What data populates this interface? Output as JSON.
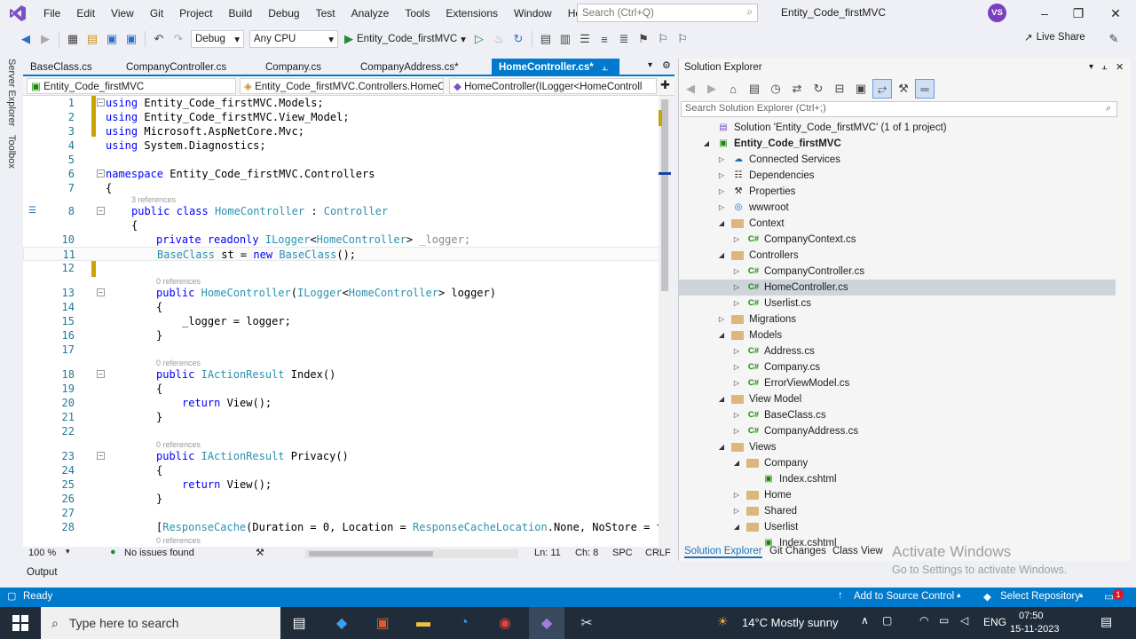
{
  "menubar": {
    "items": [
      "File",
      "Edit",
      "View",
      "Git",
      "Project",
      "Build",
      "Debug",
      "Test",
      "Analyze",
      "Tools",
      "Extensions",
      "Window",
      "Help"
    ],
    "search_placeholder": "Search (Ctrl+Q)",
    "solution_name": "Entity_Code_firstMVC",
    "avatar_initials": "VS"
  },
  "toolbar": {
    "config": "Debug",
    "platform": "Any CPU",
    "run_target": "Entity_Code_firstMVC",
    "live_share": "Live Share"
  },
  "left_rail": {
    "server_explorer": "Server Explorer",
    "toolbox": "Toolbox"
  },
  "tabs": [
    {
      "label": "BaseClass.cs"
    },
    {
      "label": "CompanyController.cs"
    },
    {
      "label": "Company.cs"
    },
    {
      "label": "CompanyAddress.cs*"
    },
    {
      "label": "HomeController.cs*"
    }
  ],
  "nav": {
    "project": "Entity_Code_firstMVC",
    "type": "Entity_Code_firstMVC.Controllers.HomeC",
    "member": "HomeController(ILogger<HomeControll"
  },
  "code": {
    "l1": "1",
    "l2": "2",
    "l3": "3",
    "l4": "4",
    "l5": "5",
    "l6": "6",
    "l7": "7",
    "l8": "8",
    "l10": "10",
    "l11": "11",
    "l12": "12",
    "l13": "13",
    "l14": "14",
    "l15": "15",
    "l16": "16",
    "l17": "17",
    "l18": "18",
    "l19": "19",
    "l20": "20",
    "l21": "21",
    "l22": "22",
    "l23": "23",
    "l24": "24",
    "l25": "25",
    "l26": "26",
    "l27": "27",
    "l28": "28",
    "using1": "Entity_Code_firstMVC.Models;",
    "using2": "Entity_Code_firstMVC.View_Model;",
    "using3": "Microsoft.AspNetCore.Mvc;",
    "using4": "System.Diagnostics;",
    "kw_using": "using",
    "kw_namespace": "namespace",
    "namespace_name": " Entity_Code_firstMVC.Controllers",
    "brace_open": "{",
    "brace_close": "}",
    "refs3": "3 references",
    "refs0": "0 references",
    "kw_public": "public",
    "kw_class": "class",
    "class_name": "HomeController",
    "colon": " : ",
    "base_type": "Controller",
    "kw_private": "private",
    "kw_readonly": "readonly",
    "ilogger": "ILogger",
    "lt": "<",
    "gt": ">",
    "logger_field": " _logger;",
    "baseclass": "BaseClass",
    "st_assign": " st = ",
    "kw_new": "new",
    "baseclass_ctor": "BaseClass",
    "ctor_end": "();",
    "ctor_name": "HomeController",
    "ctor_params_end": "> logger)",
    "assign_logger": "_logger = logger;",
    "iaction": "IActionResult",
    "index_sig": " Index()",
    "privacy_sig": " Privacy()",
    "kw_return": "return",
    "view_call": " View();",
    "resp_open": "[",
    "resp_cache": "ResponseCache",
    "resp_args": "(Duration = 0, Location = ",
    "resp_loc": "ResponseCacheLocation",
    "resp_tail": ".None, NoStore = t"
  },
  "statusline": {
    "zoom": "100 %",
    "issues": "No issues found",
    "ln": "Ln: 11",
    "ch": "Ch: 8",
    "spc": "SPC",
    "crlf": "CRLF"
  },
  "output_label": "Output",
  "statusbar": {
    "ready": "Ready",
    "add_source": "Add to Source Control",
    "select_repo": "Select Repository",
    "notif_count": "1"
  },
  "solution_explorer": {
    "title": "Solution Explorer",
    "search_placeholder": "Search Solution Explorer (Ctrl+;)",
    "items": [
      {
        "label": "Solution 'Entity_Code_firstMVC' (1 of 1 project)"
      },
      {
        "label": "Entity_Code_firstMVC"
      },
      {
        "label": "Connected Services"
      },
      {
        "label": "Dependencies"
      },
      {
        "label": "Properties"
      },
      {
        "label": "wwwroot"
      },
      {
        "label": "Context"
      },
      {
        "label": "CompanyContext.cs"
      },
      {
        "label": "Controllers"
      },
      {
        "label": "CompanyController.cs"
      },
      {
        "label": "HomeController.cs"
      },
      {
        "label": "Userlist.cs"
      },
      {
        "label": "Migrations"
      },
      {
        "label": "Models"
      },
      {
        "label": "Address.cs"
      },
      {
        "label": "Company.cs"
      },
      {
        "label": "ErrorViewModel.cs"
      },
      {
        "label": "View Model"
      },
      {
        "label": "BaseClass.cs"
      },
      {
        "label": "CompanyAddress.cs"
      },
      {
        "label": "Views"
      },
      {
        "label": "Company"
      },
      {
        "label": "Index.cshtml"
      },
      {
        "label": "Home"
      },
      {
        "label": "Shared"
      },
      {
        "label": "Userlist"
      },
      {
        "label": "Index.cshtml"
      }
    ],
    "bottom_tabs": [
      "Solution Explorer",
      "Git Changes",
      "Class View"
    ],
    "cs_badge": "C#"
  },
  "watermark": {
    "line1": "Activate Windows",
    "line2": "Go to Settings to activate Windows."
  },
  "taskbar": {
    "search_placeholder": "Type here to search",
    "weather": "14°C  Mostly sunny",
    "lang": "ENG",
    "time": "07:50",
    "date": "15-11-2023"
  }
}
